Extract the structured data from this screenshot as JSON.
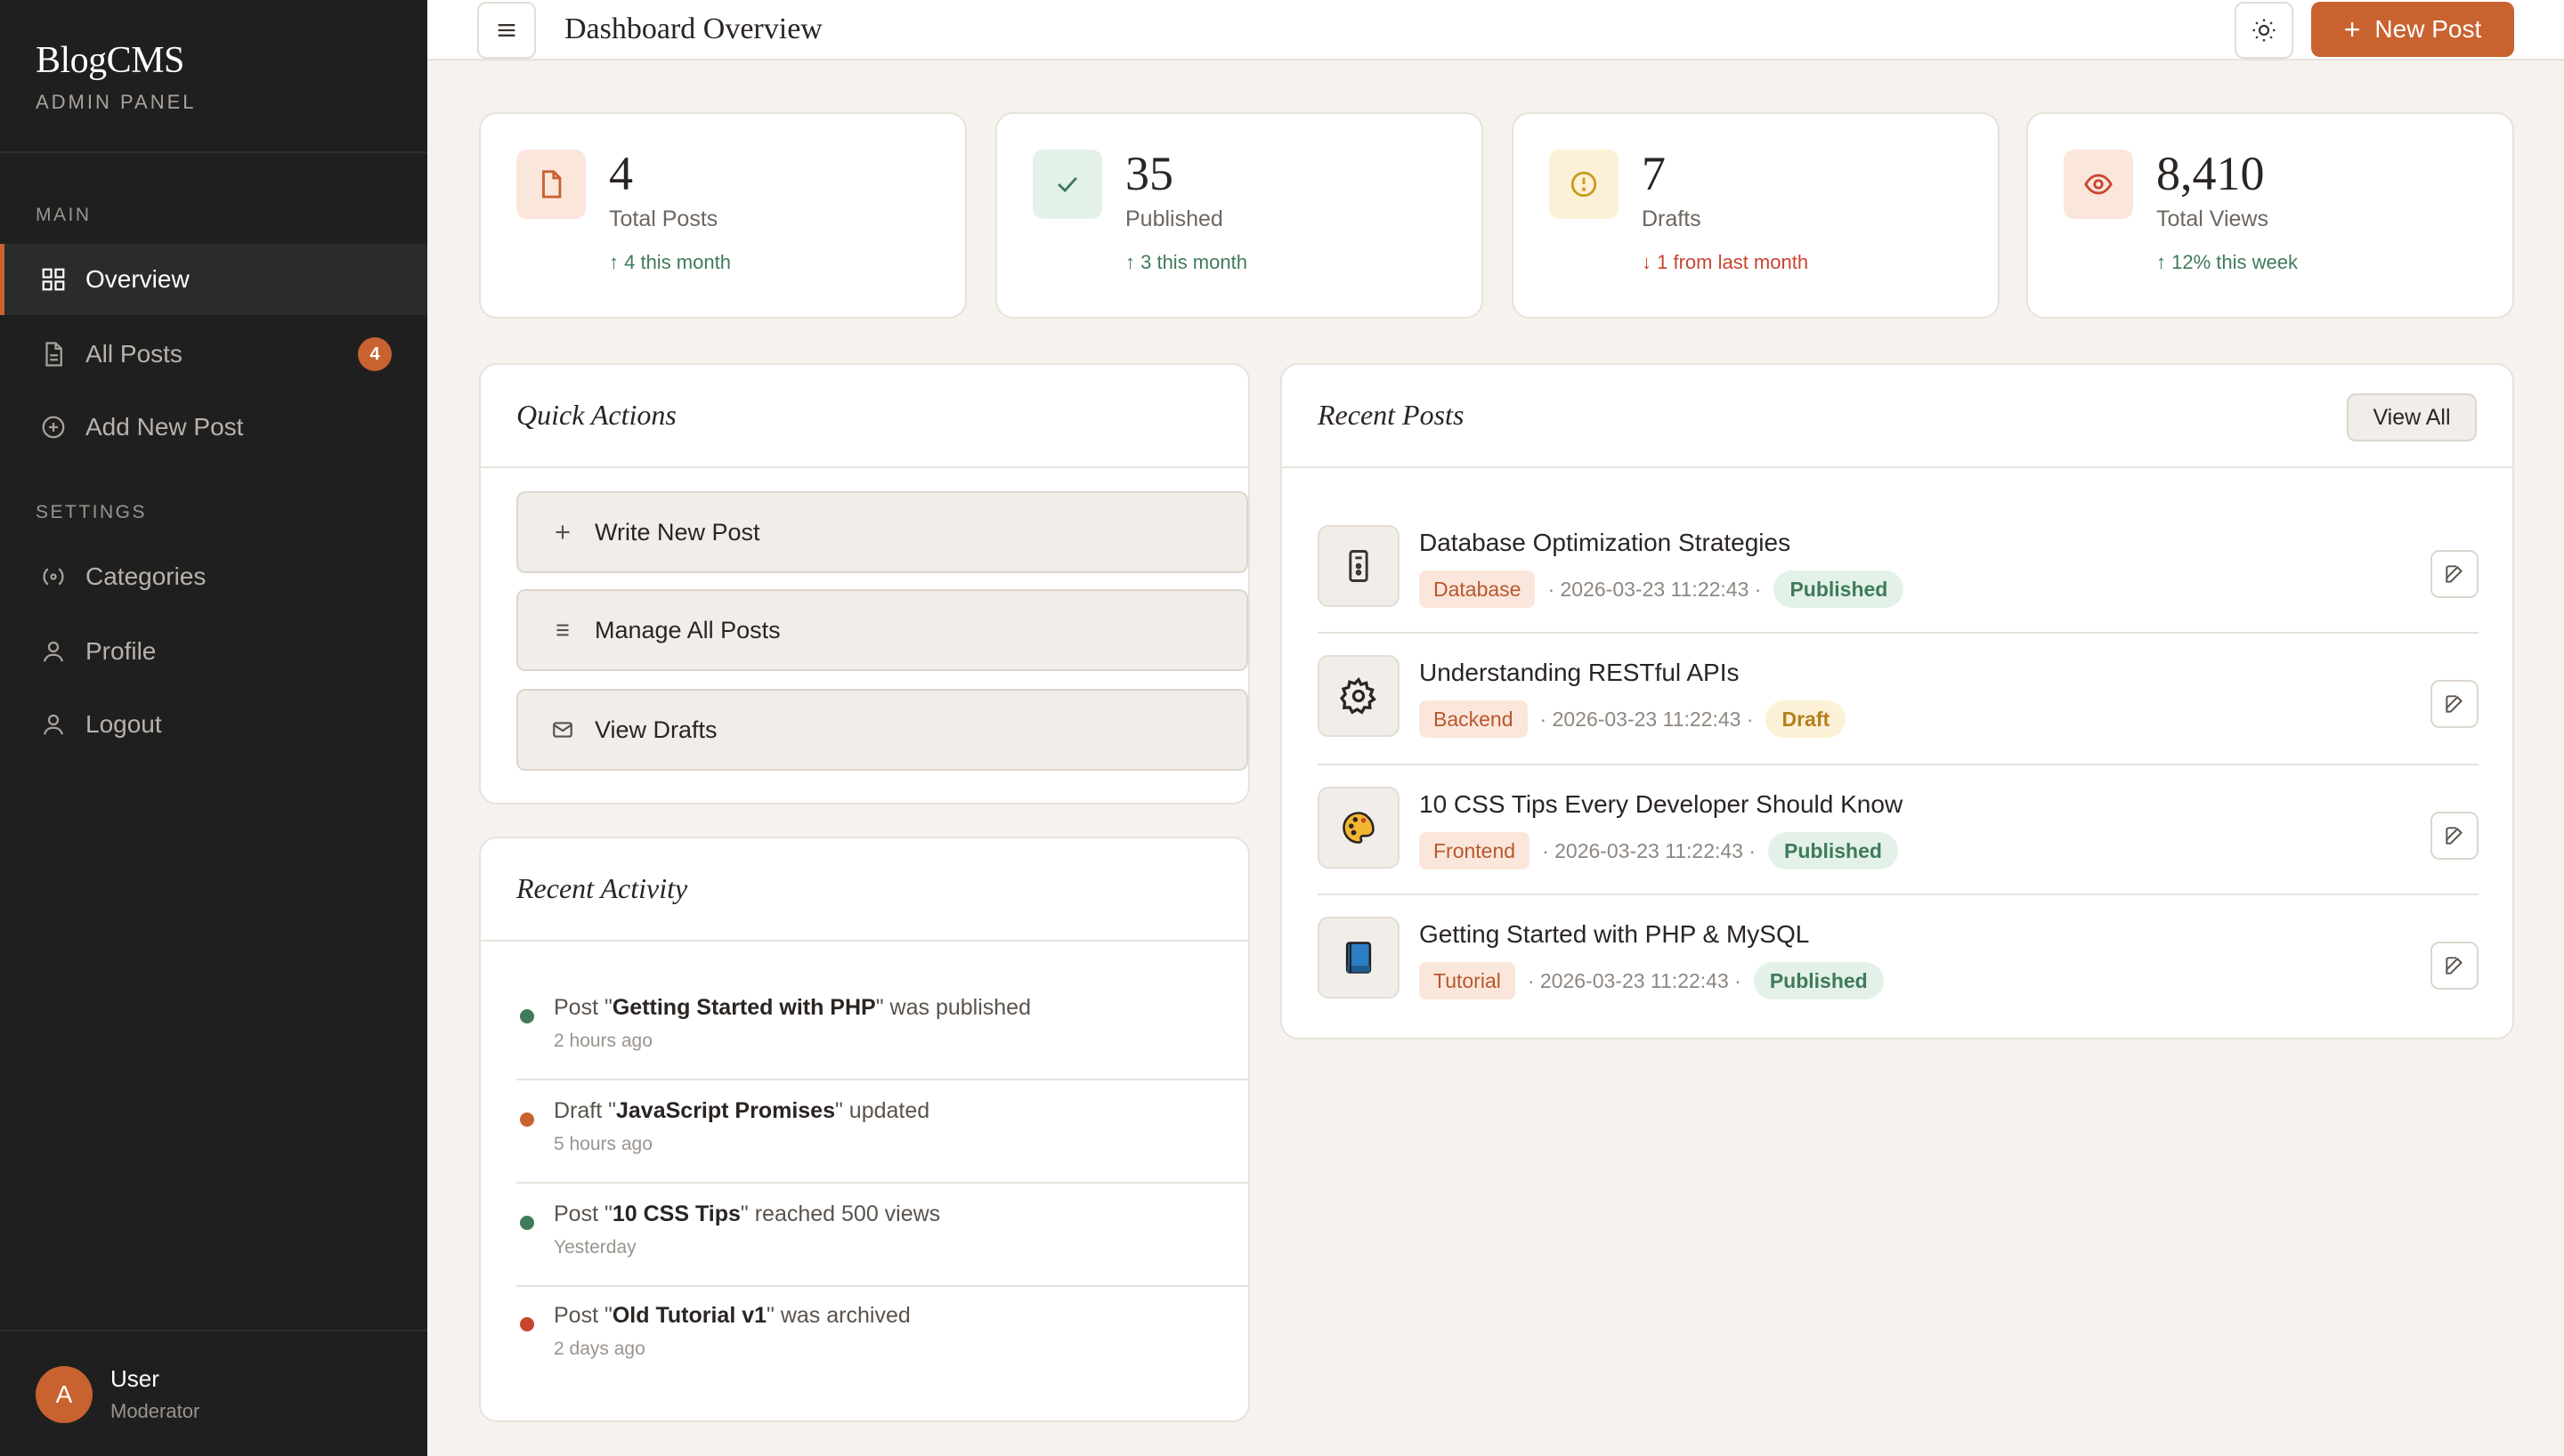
{
  "sidebar": {
    "brand": "BlogCMS",
    "brand_sub": "ADMIN PANEL",
    "section_main": "MAIN",
    "section_settings": "SETTINGS",
    "items": [
      {
        "label": "Overview",
        "icon": "grid-icon",
        "active": true
      },
      {
        "label": "All Posts",
        "icon": "document-icon",
        "badge": "4"
      },
      {
        "label": "Add New Post",
        "icon": "plus-circle-icon"
      },
      {
        "label": "Categories",
        "icon": "tag-icon"
      },
      {
        "label": "Profile",
        "icon": "user-icon"
      },
      {
        "label": "Logout",
        "icon": "logout-icon"
      }
    ],
    "user": {
      "initial": "A",
      "name": "User",
      "role": "Moderator"
    }
  },
  "header": {
    "title": "Dashboard Overview",
    "new_post_label": "New Post"
  },
  "stats": [
    {
      "value": "4",
      "label": "Total Posts",
      "trend": "↑ 4 this month",
      "direction": "up",
      "icon": "file-icon",
      "icon_bg": "#fbe6dc",
      "icon_color": "#c8622f"
    },
    {
      "value": "35",
      "label": "Published",
      "trend": "↑ 3 this month",
      "direction": "up",
      "icon": "check-icon",
      "icon_bg": "#e3f1e8",
      "icon_color": "#3f7a5a"
    },
    {
      "value": "7",
      "label": "Drafts",
      "trend": "↓ 1 from last month",
      "direction": "down",
      "icon": "clock-icon",
      "icon_bg": "#fcf1d6",
      "icon_color": "#c99a20"
    },
    {
      "value": "8,410",
      "label": "Total Views",
      "trend": "↑ 12% this week",
      "direction": "up",
      "icon": "eye-icon",
      "icon_bg": "#fbe6dc",
      "icon_color": "#c8442f"
    }
  ],
  "quick_actions": {
    "title": "Quick Actions",
    "items": [
      {
        "label": "Write New Post",
        "icon": "plus-icon"
      },
      {
        "label": "Manage All Posts",
        "icon": "list-icon"
      },
      {
        "label": "View Drafts",
        "icon": "mail-icon"
      }
    ]
  },
  "recent_activity": {
    "title": "Recent Activity",
    "items": [
      {
        "prefix": "Post \"",
        "bold": "Getting Started with PHP",
        "suffix": "\" was published",
        "time": "2 hours ago",
        "color": "#3f7a5a"
      },
      {
        "prefix": "Draft \"",
        "bold": "JavaScript Promises",
        "suffix": "\" updated",
        "time": "5 hours ago",
        "color": "#c8622f"
      },
      {
        "prefix": "Post \"",
        "bold": "10 CSS Tips",
        "suffix": "\" reached 500 views",
        "time": "Yesterday",
        "color": "#3f7a5a"
      },
      {
        "prefix": "Post \"",
        "bold": "Old Tutorial v1",
        "suffix": "\" was archived",
        "time": "2 days ago",
        "color": "#c8442f"
      }
    ]
  },
  "recent_posts": {
    "title": "Recent Posts",
    "view_all": "View All",
    "items": [
      {
        "title": "Database Optimization Strategies",
        "category": "Database",
        "date": "· 2026-03-23 11:22:43 ·",
        "status": "Published",
        "icon": "server-icon"
      },
      {
        "title": "Understanding RESTful APIs",
        "category": "Backend",
        "date": "· 2026-03-23 11:22:43 ·",
        "status": "Draft",
        "icon": "gear-icon"
      },
      {
        "title": "10 CSS Tips Every Developer Should Know",
        "category": "Frontend",
        "date": "· 2026-03-23 11:22:43 ·",
        "status": "Published",
        "icon": "palette-icon"
      },
      {
        "title": "Getting Started with PHP & MySQL",
        "category": "Tutorial",
        "date": "· 2026-03-23 11:22:43 ·",
        "status": "Published",
        "icon": "book-icon"
      }
    ]
  }
}
